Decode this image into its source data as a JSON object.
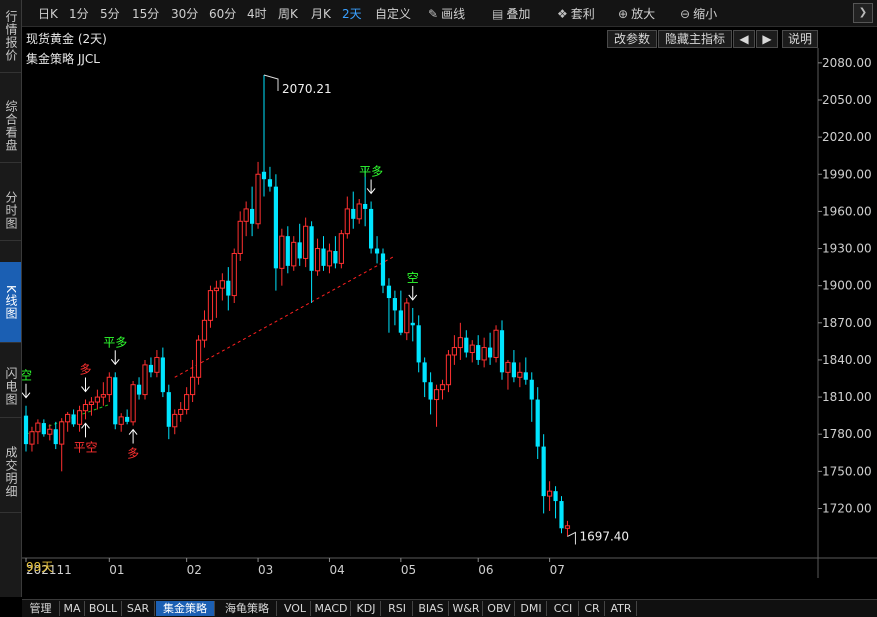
{
  "left_sidebar": {
    "tabs": [
      {
        "label": "行情报价",
        "active": false
      },
      {
        "label": "综合看盘",
        "active": false
      },
      {
        "label": "分时图",
        "active": false
      },
      {
        "label": "K线图",
        "active": true
      },
      {
        "label": "闪电图",
        "active": false
      },
      {
        "label": "成交明细",
        "active": false
      }
    ]
  },
  "toolbar": {
    "periods": [
      "日K",
      "1分",
      "5分",
      "15分",
      "30分",
      "60分",
      "4时",
      "周K",
      "月K",
      "2天",
      "自定义"
    ],
    "active_period": "2天",
    "tools": [
      {
        "label": "画线",
        "icon": "pencil-icon"
      },
      {
        "label": "叠加",
        "icon": "overlay-icon"
      },
      {
        "label": "套利",
        "icon": "arbitrage-icon"
      },
      {
        "label": "放大",
        "icon": "zoom-in-icon"
      },
      {
        "label": "缩小",
        "icon": "zoom-out-icon"
      }
    ]
  },
  "header": {
    "title": "现货黄金 (2天)",
    "buttons": [
      "改参数",
      "隐藏主指标"
    ],
    "help": "说明"
  },
  "strategy_label": "集金策略 JJCL",
  "period_count": "99天",
  "bottom_tabs": [
    "管理",
    "MA",
    "BOLL",
    "SAR",
    "集金策略",
    "海龟策略",
    "VOL",
    "MACD",
    "KDJ",
    "RSI",
    "BIAS",
    "W&R",
    "OBV",
    "DMI",
    "CCI",
    "CR",
    "ATR"
  ],
  "active_bottom_tab": "集金策略",
  "chart_data": {
    "type": "candlestick",
    "y_ticks": [
      "2080.00",
      "2050.00",
      "2020.00",
      "1990.00",
      "1960.00",
      "1930.00",
      "1900.00",
      "1870.00",
      "1840.00",
      "1810.00",
      "1780.00",
      "1750.00",
      "1720.00"
    ],
    "ylim": [
      1680,
      2092
    ],
    "x_labels": [
      {
        "label": "202111",
        "index": 0
      },
      {
        "label": "01",
        "index": 14
      },
      {
        "label": "02",
        "index": 27
      },
      {
        "label": "03",
        "index": 39
      },
      {
        "label": "04",
        "index": 51
      },
      {
        "label": "05",
        "index": 63
      },
      {
        "label": "06",
        "index": 76
      },
      {
        "label": "07",
        "index": 88
      }
    ],
    "colors": {
      "up": "#ff3030",
      "down": "#00e5ff",
      "signal_sell": "#30ff30",
      "signal_buy": "#ff3030",
      "arrow": "#ffffff",
      "trend": "#ff2020"
    },
    "high_label": {
      "text": "2070.21",
      "index": 40,
      "value": 2070.21
    },
    "low_label": {
      "text": "1697.40",
      "index": 91,
      "value": 1697.4
    },
    "signals": [
      {
        "text": "空",
        "index": 0,
        "color": "green",
        "pos": "above"
      },
      {
        "text": "多",
        "index": 10,
        "color": "red",
        "pos": "above"
      },
      {
        "text": "平空",
        "index": 10,
        "color": "red",
        "pos": "below"
      },
      {
        "text": "平多",
        "index": 15,
        "color": "green",
        "pos": "above"
      },
      {
        "text": "多",
        "index": 18,
        "color": "red",
        "pos": "below"
      },
      {
        "text": "平多",
        "index": 58,
        "color": "green",
        "pos": "above"
      },
      {
        "text": "空",
        "index": 65,
        "color": "green",
        "pos": "above"
      }
    ],
    "candles": [
      {
        "o": 1795,
        "h": 1803,
        "l": 1766,
        "c": 1772
      },
      {
        "o": 1772,
        "h": 1786,
        "l": 1766,
        "c": 1782
      },
      {
        "o": 1782,
        "h": 1792,
        "l": 1772,
        "c": 1789
      },
      {
        "o": 1789,
        "h": 1792,
        "l": 1778,
        "c": 1780
      },
      {
        "o": 1780,
        "h": 1788,
        "l": 1775,
        "c": 1784
      },
      {
        "o": 1784,
        "h": 1790,
        "l": 1768,
        "c": 1772
      },
      {
        "o": 1772,
        "h": 1793,
        "l": 1750,
        "c": 1790
      },
      {
        "o": 1790,
        "h": 1798,
        "l": 1782,
        "c": 1796
      },
      {
        "o": 1796,
        "h": 1800,
        "l": 1786,
        "c": 1788
      },
      {
        "o": 1788,
        "h": 1803,
        "l": 1782,
        "c": 1799
      },
      {
        "o": 1799,
        "h": 1808,
        "l": 1792,
        "c": 1804
      },
      {
        "o": 1804,
        "h": 1810,
        "l": 1795,
        "c": 1806
      },
      {
        "o": 1806,
        "h": 1816,
        "l": 1800,
        "c": 1810
      },
      {
        "o": 1810,
        "h": 1822,
        "l": 1803,
        "c": 1812
      },
      {
        "o": 1812,
        "h": 1830,
        "l": 1806,
        "c": 1826
      },
      {
        "o": 1826,
        "h": 1830,
        "l": 1784,
        "c": 1788
      },
      {
        "o": 1788,
        "h": 1797,
        "l": 1782,
        "c": 1794
      },
      {
        "o": 1794,
        "h": 1800,
        "l": 1788,
        "c": 1790
      },
      {
        "o": 1790,
        "h": 1823,
        "l": 1787,
        "c": 1820
      },
      {
        "o": 1820,
        "h": 1826,
        "l": 1808,
        "c": 1812
      },
      {
        "o": 1812,
        "h": 1840,
        "l": 1808,
        "c": 1836
      },
      {
        "o": 1836,
        "h": 1842,
        "l": 1826,
        "c": 1830
      },
      {
        "o": 1830,
        "h": 1848,
        "l": 1826,
        "c": 1842
      },
      {
        "o": 1842,
        "h": 1850,
        "l": 1810,
        "c": 1814
      },
      {
        "o": 1814,
        "h": 1820,
        "l": 1776,
        "c": 1786
      },
      {
        "o": 1786,
        "h": 1800,
        "l": 1780,
        "c": 1796
      },
      {
        "o": 1796,
        "h": 1806,
        "l": 1790,
        "c": 1800
      },
      {
        "o": 1800,
        "h": 1818,
        "l": 1796,
        "c": 1812
      },
      {
        "o": 1812,
        "h": 1840,
        "l": 1806,
        "c": 1826
      },
      {
        "o": 1826,
        "h": 1860,
        "l": 1820,
        "c": 1856
      },
      {
        "o": 1856,
        "h": 1880,
        "l": 1850,
        "c": 1872
      },
      {
        "o": 1872,
        "h": 1900,
        "l": 1866,
        "c": 1896
      },
      {
        "o": 1896,
        "h": 1904,
        "l": 1874,
        "c": 1898
      },
      {
        "o": 1898,
        "h": 1910,
        "l": 1888,
        "c": 1904
      },
      {
        "o": 1904,
        "h": 1915,
        "l": 1880,
        "c": 1892
      },
      {
        "o": 1892,
        "h": 1930,
        "l": 1886,
        "c": 1926
      },
      {
        "o": 1926,
        "h": 1960,
        "l": 1920,
        "c": 1952
      },
      {
        "o": 1952,
        "h": 1968,
        "l": 1940,
        "c": 1962
      },
      {
        "o": 1962,
        "h": 1980,
        "l": 1940,
        "c": 1950
      },
      {
        "o": 1950,
        "h": 2000,
        "l": 1946,
        "c": 1990
      },
      {
        "o": 1992,
        "h": 2070.21,
        "l": 1972,
        "c": 1986
      },
      {
        "o": 1986,
        "h": 1996,
        "l": 1976,
        "c": 1980
      },
      {
        "o": 1980,
        "h": 1990,
        "l": 1896,
        "c": 1914
      },
      {
        "o": 1914,
        "h": 1946,
        "l": 1900,
        "c": 1940
      },
      {
        "o": 1940,
        "h": 1948,
        "l": 1910,
        "c": 1916
      },
      {
        "o": 1916,
        "h": 1940,
        "l": 1912,
        "c": 1935
      },
      {
        "o": 1935,
        "h": 1950,
        "l": 1916,
        "c": 1922
      },
      {
        "o": 1922,
        "h": 1955,
        "l": 1915,
        "c": 1948
      },
      {
        "o": 1948,
        "h": 1952,
        "l": 1886,
        "c": 1912
      },
      {
        "o": 1912,
        "h": 1938,
        "l": 1908,
        "c": 1930
      },
      {
        "o": 1930,
        "h": 1940,
        "l": 1912,
        "c": 1916
      },
      {
        "o": 1916,
        "h": 1934,
        "l": 1910,
        "c": 1928
      },
      {
        "o": 1928,
        "h": 1940,
        "l": 1914,
        "c": 1918
      },
      {
        "o": 1918,
        "h": 1945,
        "l": 1914,
        "c": 1942
      },
      {
        "o": 1942,
        "h": 1972,
        "l": 1938,
        "c": 1962
      },
      {
        "o": 1962,
        "h": 1976,
        "l": 1946,
        "c": 1954
      },
      {
        "o": 1954,
        "h": 1970,
        "l": 1950,
        "c": 1966
      },
      {
        "o": 1966,
        "h": 1996,
        "l": 1948,
        "c": 1962
      },
      {
        "o": 1962,
        "h": 1968,
        "l": 1926,
        "c": 1930
      },
      {
        "o": 1930,
        "h": 1940,
        "l": 1918,
        "c": 1926
      },
      {
        "o": 1926,
        "h": 1930,
        "l": 1894,
        "c": 1900
      },
      {
        "o": 1900,
        "h": 1906,
        "l": 1862,
        "c": 1890
      },
      {
        "o": 1890,
        "h": 1896,
        "l": 1868,
        "c": 1880
      },
      {
        "o": 1880,
        "h": 1896,
        "l": 1860,
        "c": 1862
      },
      {
        "o": 1862,
        "h": 1890,
        "l": 1856,
        "c": 1886
      },
      {
        "o": 1870,
        "h": 1882,
        "l": 1855,
        "c": 1868
      },
      {
        "o": 1868,
        "h": 1876,
        "l": 1830,
        "c": 1838
      },
      {
        "o": 1838,
        "h": 1842,
        "l": 1810,
        "c": 1822
      },
      {
        "o": 1822,
        "h": 1830,
        "l": 1796,
        "c": 1808
      },
      {
        "o": 1808,
        "h": 1820,
        "l": 1786,
        "c": 1816
      },
      {
        "o": 1816,
        "h": 1824,
        "l": 1808,
        "c": 1820
      },
      {
        "o": 1820,
        "h": 1848,
        "l": 1814,
        "c": 1844
      },
      {
        "o": 1844,
        "h": 1860,
        "l": 1836,
        "c": 1850
      },
      {
        "o": 1850,
        "h": 1870,
        "l": 1840,
        "c": 1858
      },
      {
        "o": 1858,
        "h": 1864,
        "l": 1842,
        "c": 1846
      },
      {
        "o": 1846,
        "h": 1856,
        "l": 1838,
        "c": 1852
      },
      {
        "o": 1852,
        "h": 1860,
        "l": 1836,
        "c": 1840
      },
      {
        "o": 1840,
        "h": 1858,
        "l": 1834,
        "c": 1850
      },
      {
        "o": 1850,
        "h": 1862,
        "l": 1836,
        "c": 1842
      },
      {
        "o": 1842,
        "h": 1868,
        "l": 1838,
        "c": 1864
      },
      {
        "o": 1864,
        "h": 1872,
        "l": 1824,
        "c": 1830
      },
      {
        "o": 1830,
        "h": 1840,
        "l": 1816,
        "c": 1838
      },
      {
        "o": 1838,
        "h": 1848,
        "l": 1822,
        "c": 1826
      },
      {
        "o": 1826,
        "h": 1838,
        "l": 1818,
        "c": 1830
      },
      {
        "o": 1830,
        "h": 1842,
        "l": 1820,
        "c": 1824
      },
      {
        "o": 1824,
        "h": 1830,
        "l": 1790,
        "c": 1808
      },
      {
        "o": 1808,
        "h": 1818,
        "l": 1760,
        "c": 1770
      },
      {
        "o": 1770,
        "h": 1780,
        "l": 1716,
        "c": 1730
      },
      {
        "o": 1730,
        "h": 1742,
        "l": 1718,
        "c": 1734
      },
      {
        "o": 1734,
        "h": 1738,
        "l": 1712,
        "c": 1726
      },
      {
        "o": 1726,
        "h": 1730,
        "l": 1700,
        "c": 1704
      },
      {
        "o": 1704,
        "h": 1710,
        "l": 1697.4,
        "c": 1706
      }
    ]
  }
}
